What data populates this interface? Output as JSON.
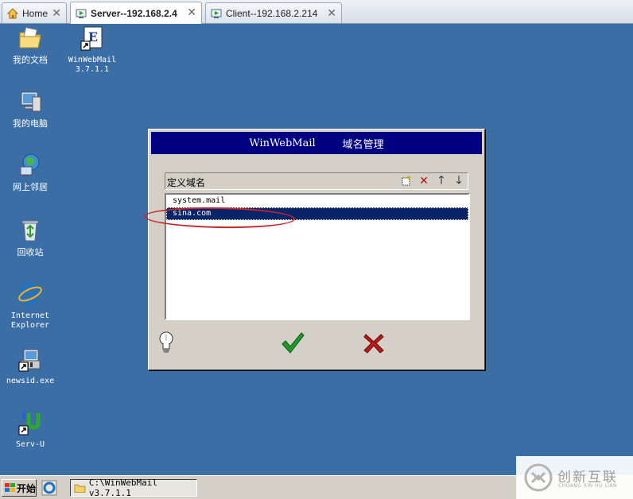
{
  "tabs": [
    {
      "label": "Home"
    },
    {
      "label": "Server--192.168.2.4"
    },
    {
      "label": "Client--192.168.2.214"
    }
  ],
  "desktop_icons": [
    {
      "label": "我的文档"
    },
    {
      "label": "WinWebMail 3.7.1.1"
    },
    {
      "label": "我的电脑"
    },
    {
      "label": "网上邻居"
    },
    {
      "label": "回收站"
    },
    {
      "label": "Internet Explorer"
    },
    {
      "label": "newsid.exe"
    },
    {
      "label": "Serv-U"
    }
  ],
  "dialog": {
    "title_app": "WinWebMail",
    "title_section": "域名管理",
    "toolbar_caption": "定义域名",
    "domains": [
      "system.mail",
      "sina.com"
    ],
    "selected_index": 1
  },
  "taskbar": {
    "start_label": "开始",
    "task_label": "C:\\WinWebMail v3.7.1.1"
  },
  "watermark": {
    "brand": "创新互联",
    "sub": "CHUANG XIN HU LIAN"
  },
  "colors": {
    "desktop": "#3a6ea5",
    "title_bar": "#000080",
    "selection": "#0a246a",
    "annotation": "#c0282b"
  }
}
